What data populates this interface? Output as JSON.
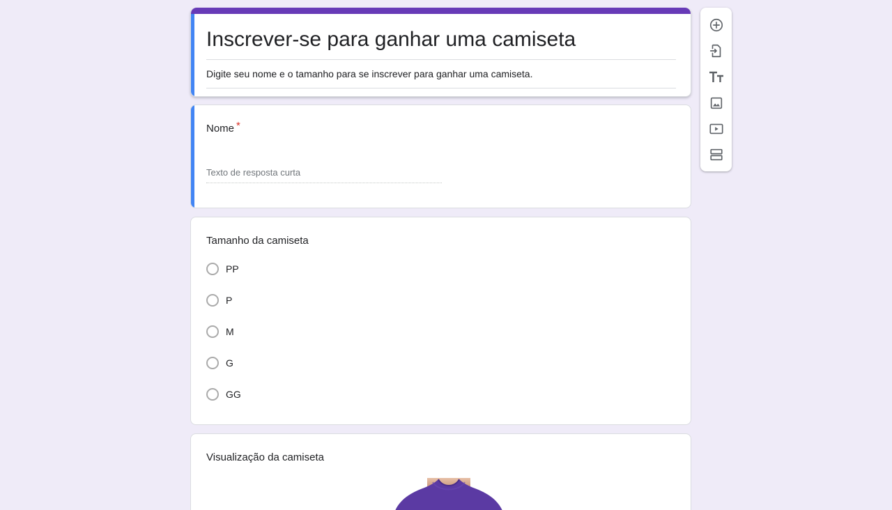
{
  "form": {
    "title": "Inscrever-se para ganhar uma camiseta",
    "description": "Digite seu nome e o tamanho para se inscrever para ganhar uma camiseta.",
    "theme_color": "#673ab7",
    "accent_color": "#4285f4"
  },
  "questions": {
    "name": {
      "title": "Nome",
      "required_mark": "*",
      "placeholder": "Texto de resposta curta"
    },
    "size": {
      "title": "Tamanho da camiseta",
      "options": [
        "PP",
        "P",
        "M",
        "G",
        "GG"
      ]
    },
    "preview": {
      "title": "Visualização da camiseta",
      "image_icon": "purple-tshirt-image"
    }
  },
  "toolbar": {
    "items": [
      {
        "icon": "add-question-icon"
      },
      {
        "icon": "import-questions-icon"
      },
      {
        "icon": "add-title-icon"
      },
      {
        "icon": "add-image-icon"
      },
      {
        "icon": "add-video-icon"
      },
      {
        "icon": "add-section-icon"
      }
    ]
  }
}
